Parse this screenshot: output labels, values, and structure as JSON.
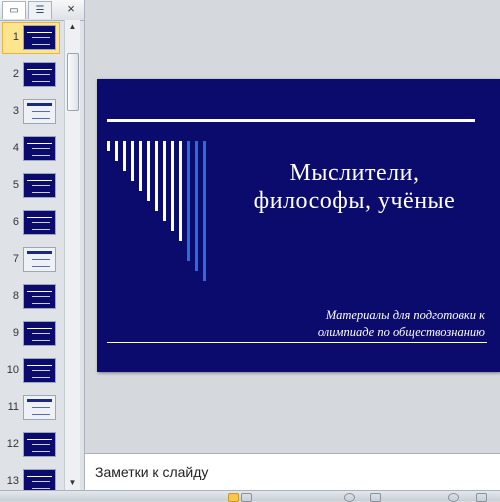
{
  "slides_pane": {
    "tab_slides_icon": "slides-tab-icon",
    "tab_outline_icon": "outline-tab-icon",
    "close_glyph": "×",
    "thumbnails": [
      {
        "number": "1",
        "selected": true
      },
      {
        "number": "2"
      },
      {
        "number": "3"
      },
      {
        "number": "4"
      },
      {
        "number": "5"
      },
      {
        "number": "6"
      },
      {
        "number": "7"
      },
      {
        "number": "8"
      },
      {
        "number": "9"
      },
      {
        "number": "10"
      },
      {
        "number": "11"
      },
      {
        "number": "12"
      },
      {
        "number": "13"
      }
    ]
  },
  "slide": {
    "title": "Мыслители,\nфилософы,  учёные",
    "subtitle": "Материалы для подготовки к\nолимпиаде по обществознанию",
    "background_color": "#0b0b6e",
    "bar_colors": [
      "#ffffff",
      "#2e6bd6"
    ]
  },
  "notes": {
    "placeholder": "Заметки к слайду"
  }
}
